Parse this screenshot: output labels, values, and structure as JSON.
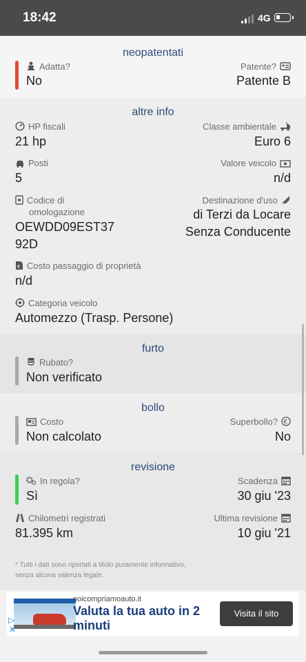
{
  "status_bar": {
    "time": "18:42",
    "network": "4G"
  },
  "neopatentati": {
    "title": "neopatentati",
    "accent_color": "#e04a3b",
    "adatta_label": "Adatta?",
    "adatta_value": "No",
    "patente_label": "Patente?",
    "patente_value": "Patente B"
  },
  "altre_info": {
    "title": "altre info",
    "hp_label": "HP fiscali",
    "hp_value": "21 hp",
    "classe_label": "Classe ambientale",
    "classe_value": "Euro 6",
    "posti_label": "Posti",
    "posti_value": "5",
    "valore_label": "Valore veicolo",
    "valore_value": "n/d",
    "codice_label_1": "Codice di",
    "codice_label_2": "omologazione",
    "codice_value_1": "OEWDD09EST37",
    "codice_value_2": "92D",
    "destinazione_label": "Destinazione d'uso",
    "destinazione_value_1": "di Terzi da Locare",
    "destinazione_value_2": "Senza Conducente",
    "costo_label": "Costo passaggio di proprietà",
    "costo_value": "n/d",
    "categoria_label": "Categoria veicolo",
    "categoria_value": "Automezzo (Trasp. Persone)"
  },
  "furto": {
    "title": "furto",
    "accent_color": "#a8a8a8",
    "rubato_label": "Rubato?",
    "rubato_value": "Non verificato"
  },
  "bollo": {
    "title": "bollo",
    "accent_color": "#a8a8a8",
    "costo_label": "Costo",
    "costo_value": "Non calcolato",
    "superbollo_label": "Superbollo?",
    "superbollo_value": "No"
  },
  "revisione": {
    "title": "revisione",
    "accent_color": "#3ccf5a",
    "regola_label": "In regola?",
    "regola_value": "Sì",
    "scadenza_label": "Scadenza",
    "scadenza_value": "30 giu '23",
    "km_label": "Chilometri registrati",
    "km_value": "81.395 km",
    "ultima_label": "Ultima revisione",
    "ultima_value": "10 giu '21"
  },
  "disclaimer": "* Tutti i dati sono riportati a titolo puramente informativo, senza alcuna valenza legale.",
  "ad": {
    "domain": "noicompriamoauto.it",
    "headline": "Valuta la tua auto in 2 minuti",
    "cta": "Visita il sito"
  },
  "colors": {
    "section_title": "#2a4b7c",
    "background": "#f2f2f2",
    "section_alt": "#e8e8e8"
  },
  "icons": [
    "baby-seat-icon",
    "license-icon",
    "gauge-icon",
    "truck-icon",
    "car-icon",
    "money-icon",
    "homologation-icon",
    "destination-icon",
    "cost-icon",
    "target-icon",
    "thief-icon",
    "card-icon",
    "euro-icon",
    "gears-icon",
    "calendar-icon",
    "road-icon"
  ]
}
